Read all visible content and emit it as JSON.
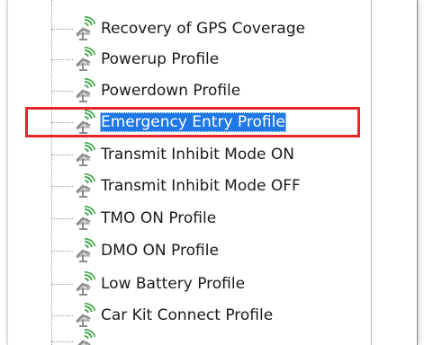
{
  "tree": {
    "items": [
      {
        "label": "Recovery of GPS Coverage",
        "icon": "gps-profile-icon",
        "selected": false
      },
      {
        "label": "Powerup Profile",
        "icon": "gps-profile-icon",
        "selected": false
      },
      {
        "label": "Powerdown Profile",
        "icon": "gps-profile-icon",
        "selected": false
      },
      {
        "label": "Emergency Entry Profile",
        "icon": "gps-profile-icon",
        "selected": true
      },
      {
        "label": "Transmit Inhibit Mode ON",
        "icon": "gps-profile-icon",
        "selected": false
      },
      {
        "label": "Transmit Inhibit Mode OFF",
        "icon": "gps-profile-icon",
        "selected": false
      },
      {
        "label": "TMO ON Profile",
        "icon": "gps-profile-icon",
        "selected": false
      },
      {
        "label": "DMO ON Profile",
        "icon": "gps-profile-icon",
        "selected": false
      },
      {
        "label": "Low Battery Profile",
        "icon": "gps-profile-icon",
        "selected": false
      },
      {
        "label": "Car Kit Connect Profile",
        "icon": "gps-profile-icon",
        "selected": false
      }
    ]
  },
  "colors": {
    "selection": "#1e78e6",
    "annotation_box": "#e8262a",
    "icon_signal": "#3aa845",
    "icon_body": "#8c8c8c"
  }
}
